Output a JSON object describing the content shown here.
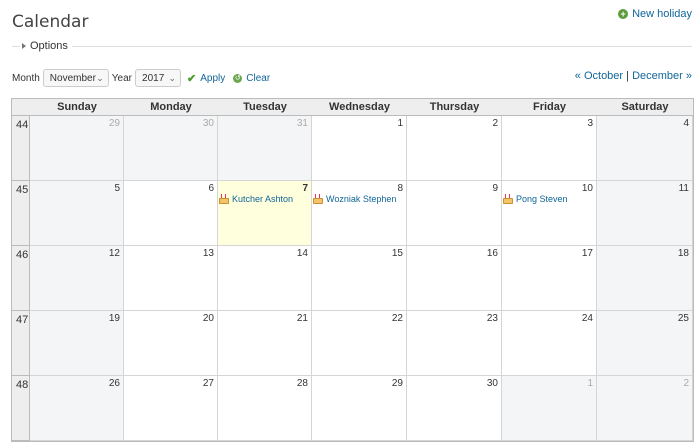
{
  "page": {
    "title": "Calendar",
    "new_holiday": "New holiday",
    "options_label": "Options"
  },
  "filter": {
    "month_label": "Month",
    "month_value": "November",
    "year_label": "Year",
    "year_value": "2017",
    "apply": "Apply",
    "clear": "Clear"
  },
  "nav": {
    "prev": "« October",
    "sep": "|",
    "next": "December »"
  },
  "calendar": {
    "days": [
      "Sunday",
      "Monday",
      "Tuesday",
      "Wednesday",
      "Thursday",
      "Friday",
      "Saturday"
    ],
    "weeks": [
      {
        "num": "44",
        "days": [
          {
            "d": "29",
            "other": true
          },
          {
            "d": "30",
            "other": true
          },
          {
            "d": "31",
            "other": true
          },
          {
            "d": "1"
          },
          {
            "d": "2"
          },
          {
            "d": "3"
          },
          {
            "d": "4"
          }
        ]
      },
      {
        "num": "45",
        "days": [
          {
            "d": "5"
          },
          {
            "d": "6"
          },
          {
            "d": "7",
            "today": true,
            "event": "Kutcher Ashton"
          },
          {
            "d": "8",
            "event": "Wozniak Stephen"
          },
          {
            "d": "9"
          },
          {
            "d": "10",
            "event": "Pong Steven"
          },
          {
            "d": "11"
          }
        ]
      },
      {
        "num": "46",
        "days": [
          {
            "d": "12"
          },
          {
            "d": "13"
          },
          {
            "d": "14"
          },
          {
            "d": "15"
          },
          {
            "d": "16"
          },
          {
            "d": "17"
          },
          {
            "d": "18"
          }
        ]
      },
      {
        "num": "47",
        "days": [
          {
            "d": "19"
          },
          {
            "d": "20"
          },
          {
            "d": "21"
          },
          {
            "d": "22"
          },
          {
            "d": "23"
          },
          {
            "d": "24"
          },
          {
            "d": "25"
          }
        ]
      },
      {
        "num": "48",
        "days": [
          {
            "d": "26"
          },
          {
            "d": "27"
          },
          {
            "d": "28"
          },
          {
            "d": "29"
          },
          {
            "d": "30"
          },
          {
            "d": "1",
            "other": true
          },
          {
            "d": "2",
            "other": true
          }
        ]
      }
    ]
  },
  "colors": {
    "link": "#116699",
    "today": "#ffffdd",
    "weekend": "#f4f5f7",
    "header": "#eeeeee"
  }
}
